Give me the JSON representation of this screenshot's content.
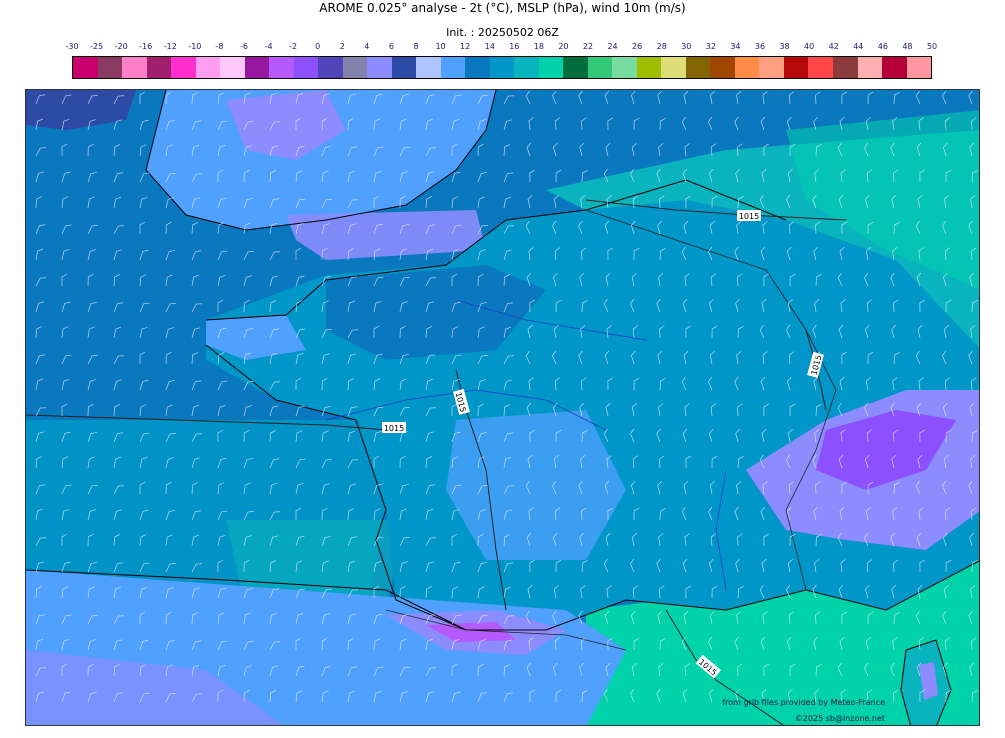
{
  "header": {
    "title": "AROME 0.025° analyse - 2t (°C), MSLP (hPa), wind 10m (m/s)",
    "init": "Init. : 20250502 06Z"
  },
  "legend": {
    "labels": [
      "-30",
      "-25",
      "-20",
      "-16",
      "-12",
      "-10",
      "-8",
      "-6",
      "-4",
      "-2",
      "0",
      "2",
      "4",
      "6",
      "8",
      "10",
      "12",
      "14",
      "16",
      "18",
      "20",
      "22",
      "24",
      "26",
      "28",
      "30",
      "32",
      "34",
      "36",
      "38",
      "40",
      "42",
      "44",
      "46",
      "48",
      "50"
    ],
    "colors": [
      "#c8006e",
      "#8b3a62",
      "#ff7fc8",
      "#a0206e",
      "#ff2fcd",
      "#ff9ef0",
      "#ffc8fa",
      "#96189e",
      "#b45aff",
      "#8c50ff",
      "#5046b9",
      "#8282aa",
      "#8c8cff",
      "#2d4ba5",
      "#afc3ff",
      "#50a0ff",
      "#0a78be",
      "#0096c8",
      "#0ab4be",
      "#00d2aa",
      "#006e3c",
      "#32c878",
      "#78dca0",
      "#a0be00",
      "#dcdc78",
      "#826400",
      "#a04600",
      "#ff8c46",
      "#ffa082",
      "#b40a0a",
      "#ff4646",
      "#8c3c3c",
      "#ffafaf",
      "#b40037",
      "#ff96a0"
    ]
  },
  "map": {
    "isobar_labels": [
      "1015",
      "1015",
      "1015",
      "1015",
      "1015"
    ],
    "colors": {
      "sea": "#0a78be",
      "land_warm": "#0096c8",
      "cool": "#50a0ff",
      "cold": "#8c8cff",
      "very_cold": "#afc3ff",
      "warm": "#00d2aa",
      "alps": "#8c50ff"
    }
  },
  "credits": {
    "source": "from grib files provided by Meteo-France",
    "copyright": "©2025 sb@inzone.net"
  }
}
